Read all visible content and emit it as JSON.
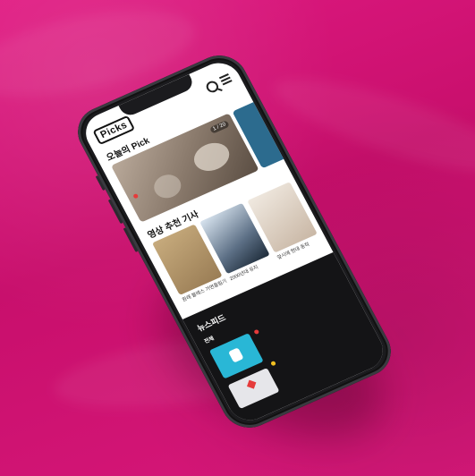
{
  "app": {
    "logo_text": "Picks"
  },
  "header": {
    "search_icon": "search-icon",
    "menu_icon": "menu-icon"
  },
  "today_pick": {
    "title": "오늘의 Pick",
    "card": {
      "badge": "1 / 20",
      "source": "",
      "lines": [
        "",
        ""
      ]
    }
  },
  "video_section": {
    "title": "영상 추천 기사",
    "items": [
      {
        "caption": "원래 블레스 가면올림기"
      },
      {
        "caption": "2000년대 유지"
      },
      {
        "caption": "앞시에 현대 동작"
      }
    ]
  },
  "newsfeed": {
    "title": "뉴스피드",
    "tabs": [
      "전체",
      "",
      "",
      "",
      ""
    ],
    "items": [
      {
        "tag": "",
        "lines": [
          "",
          "",
          ""
        ]
      },
      {
        "tag": "",
        "lines": [
          "",
          "",
          ""
        ]
      }
    ]
  },
  "colors": {
    "background": "#d6167a",
    "accent": "#e53b3b",
    "dark_panel": "#141416"
  }
}
